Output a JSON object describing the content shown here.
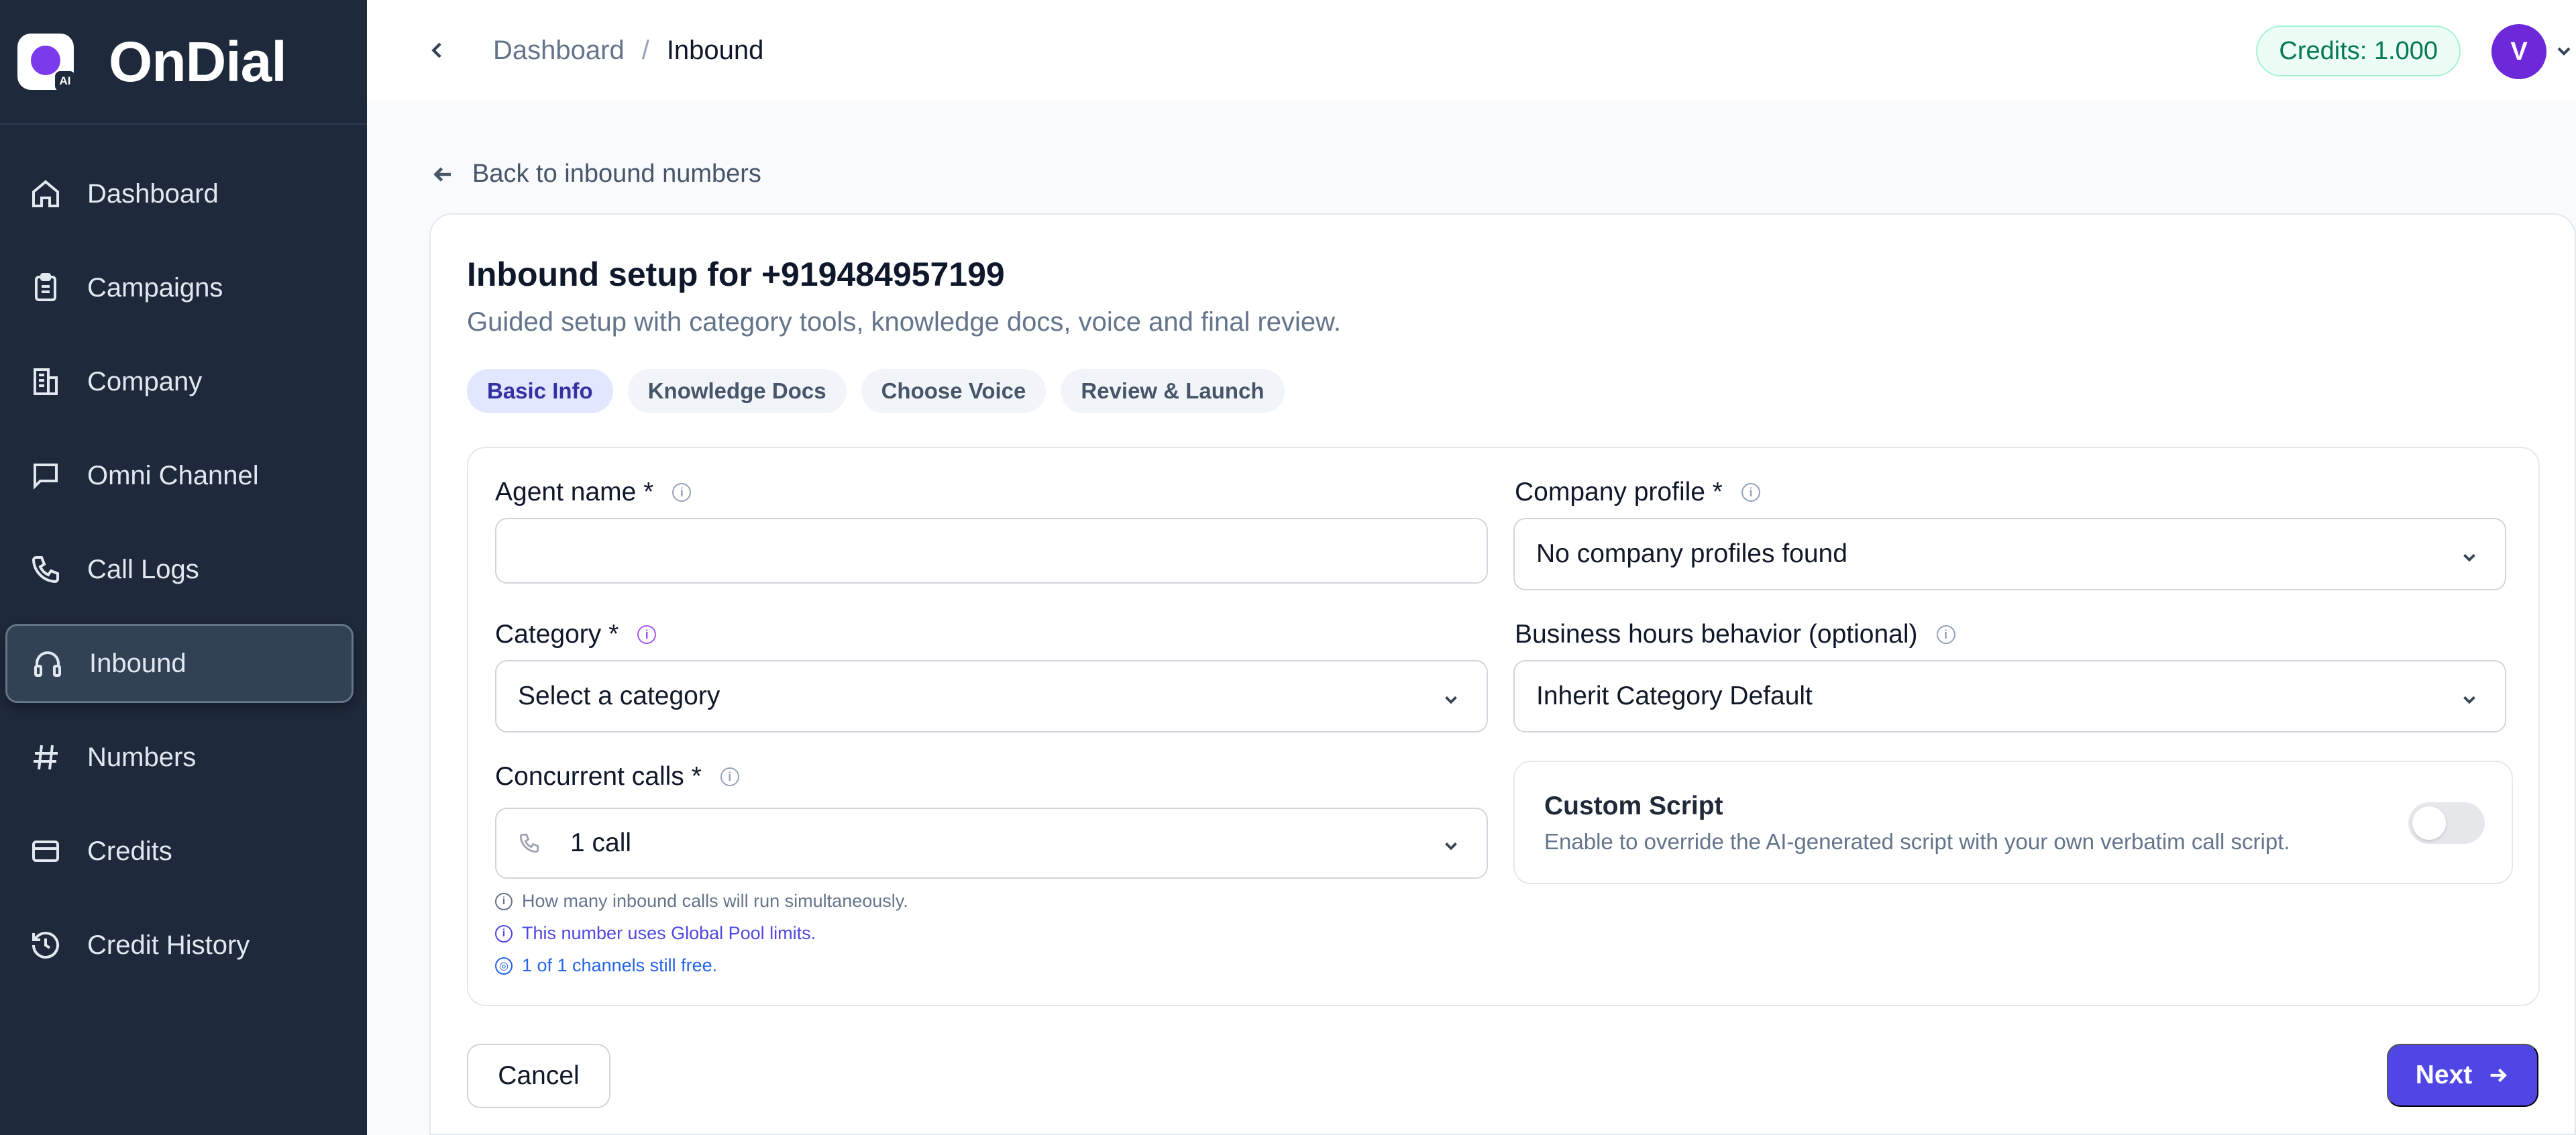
{
  "brand": {
    "name": "OnDial",
    "logo_badge": "AI"
  },
  "sidebar": {
    "items": [
      {
        "label": "Dashboard",
        "icon": "home-icon"
      },
      {
        "label": "Campaigns",
        "icon": "clipboard-icon"
      },
      {
        "label": "Company",
        "icon": "building-icon"
      },
      {
        "label": "Omni Channel",
        "icon": "chat-icon"
      },
      {
        "label": "Call Logs",
        "icon": "phone-icon"
      },
      {
        "label": "Inbound",
        "icon": "headphones-icon",
        "active": true
      },
      {
        "label": "Numbers",
        "icon": "hash-icon"
      },
      {
        "label": "Credits",
        "icon": "credit-card-icon"
      },
      {
        "label": "Credit History",
        "icon": "history-icon"
      }
    ]
  },
  "topbar": {
    "breadcrumb": [
      "Dashboard",
      "Inbound"
    ],
    "breadcrumb_sep": "/",
    "credits": "Credits: 1.000",
    "avatar_initial": "V"
  },
  "page": {
    "back_link": "Back to inbound numbers",
    "title": "Inbound setup for +919484957199",
    "subtitle": "Guided setup with category tools, knowledge docs, voice and final review.",
    "steps": [
      "Basic Info",
      "Knowledge Docs",
      "Choose Voice",
      "Review & Launch"
    ],
    "active_step": 0
  },
  "form": {
    "agent_name": {
      "label": "Agent name *",
      "value": ""
    },
    "company_profile": {
      "label": "Company profile *",
      "value": "No company profiles found"
    },
    "category": {
      "label": "Category *",
      "value": "Select a category"
    },
    "business_hours": {
      "label": "Business hours behavior (optional)",
      "value": "Inherit Category Default"
    },
    "concurrent_calls": {
      "label": "Concurrent calls *",
      "value": "1 call"
    },
    "hints": [
      "How many inbound calls will run simultaneously.",
      "This number uses Global Pool limits.",
      "1 of 1 channels still free."
    ],
    "custom_script": {
      "title": "Custom Script",
      "description": "Enable to override the AI-generated script with your own verbatim call script.",
      "enabled": false
    }
  },
  "actions": {
    "cancel": "Cancel",
    "next": "Next"
  },
  "colors": {
    "sidebar_bg": "#1e293b",
    "accent": "#4f46e5",
    "credits_green": "#047857",
    "avatar": "#6d28d9"
  }
}
